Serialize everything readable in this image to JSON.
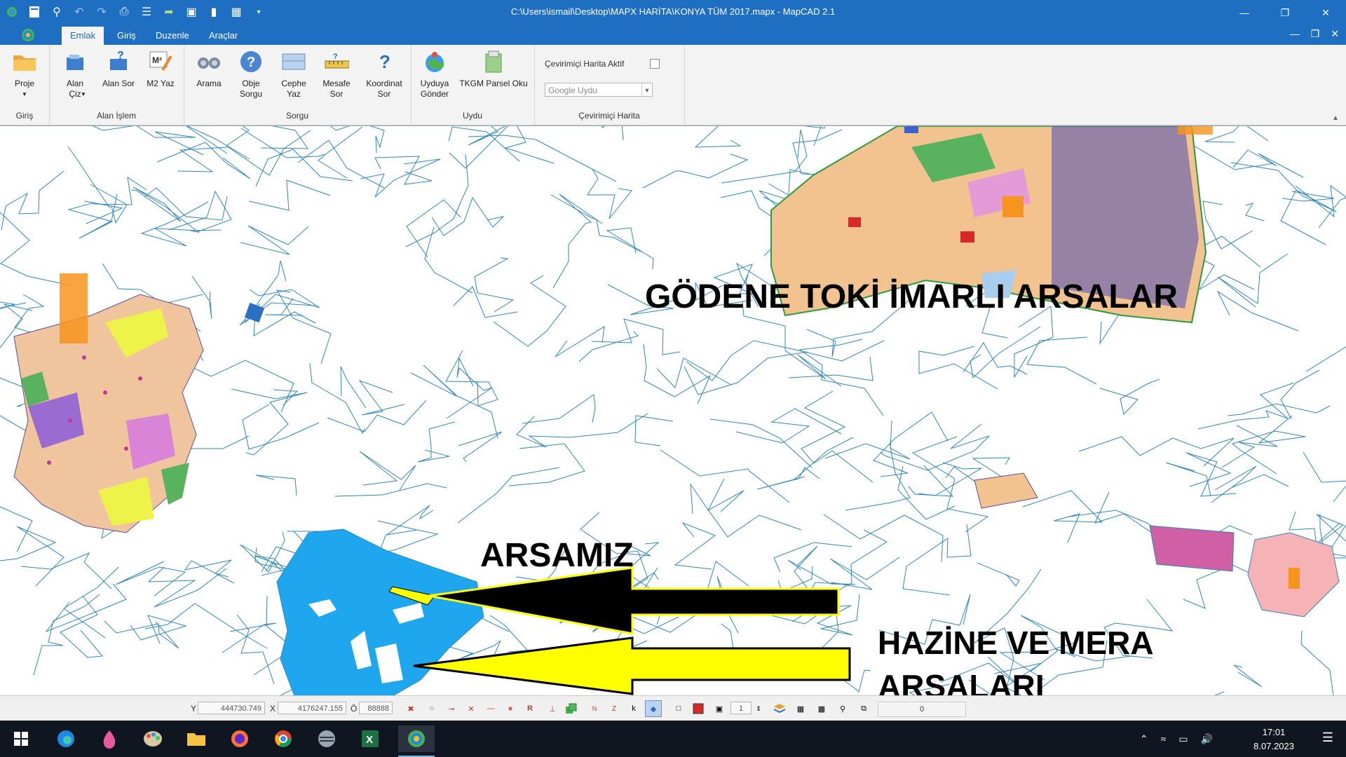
{
  "window": {
    "title": "C:\\Users\\ismail\\Desktop\\MAPX HARİTA\\KONYA TÜM 2017.mapx - MapCAD 2.1",
    "controls": [
      "minimize",
      "restore",
      "close"
    ]
  },
  "quick_access": [
    "app-icon",
    "new-icon",
    "zoom-icon",
    "undo-icon",
    "redo-icon",
    "print-icon",
    "list-icon",
    "export-icon",
    "save-icon",
    "bookmark-icon",
    "layout-icon",
    "dropdown-icon"
  ],
  "tabs": [
    {
      "label": "Emlak",
      "active": true
    },
    {
      "label": "Giriş",
      "active": false
    },
    {
      "label": "Duzenle",
      "active": false
    },
    {
      "label": "Araçlar",
      "active": false
    }
  ],
  "ribbon": {
    "groups": {
      "giris": {
        "label": "Giriş",
        "buttons": [
          {
            "label": "Proje",
            "icon": "folder-icon"
          }
        ]
      },
      "alan_islem": {
        "label": "Alan İşlem",
        "buttons": [
          {
            "label": "Alan Çiz",
            "icon": "draw-area-icon"
          },
          {
            "label": "Alan Sor",
            "icon": "query-area-icon"
          },
          {
            "label": "M2 Yaz",
            "icon": "m2-write-icon"
          }
        ]
      },
      "sorgu": {
        "label": "Sorgu",
        "buttons": [
          {
            "label": "Arama",
            "icon": "binoculars-icon"
          },
          {
            "label": "Obje Sorgu",
            "icon": "question-icon"
          },
          {
            "label": "Cephe Yaz",
            "icon": "facade-icon"
          },
          {
            "label": "Mesafe Sor",
            "icon": "ruler-icon"
          },
          {
            "label": "Koordinat Sor",
            "icon": "coordinate-question-icon"
          }
        ]
      },
      "uydu": {
        "label": "Uydu",
        "buttons": [
          {
            "label": "Uyduya Gönder",
            "icon": "globe-icon"
          },
          {
            "label": "TKGM Parsel Oku",
            "icon": "parcel-read-icon"
          }
        ]
      },
      "cevrimici": {
        "label": "Çevirimiçi Harita",
        "checkbox_label": "Çevirimiçi Harita Aktif",
        "checked": false,
        "combo_value": "Google Uydu"
      }
    }
  },
  "map": {
    "labels": {
      "toki": "GÖDENE TOKİ İMARLI ARSALAR",
      "arsamiz": "ARSAMIZ",
      "hazine_line1": "HAZİNE VE MERA",
      "hazine_line2": "ARSALARI"
    },
    "colors": {
      "line": "#2f86b8",
      "water": "#1ea7ee",
      "residential": "#f2c28f",
      "arrow_yellow": "#ffff00",
      "arrow_black": "#000000",
      "zone_pink": "#d15fa6"
    }
  },
  "status": {
    "y_label": "Y",
    "y_value": "444730.749",
    "x_label": "X",
    "x_value": "4176247.155",
    "o_label": "Ö",
    "o_value": "88888",
    "scale_value": "1",
    "counter": "0"
  },
  "taskbar": {
    "apps": [
      "windows-start-icon",
      "edge-icon",
      "paint-drop-icon",
      "palette-icon",
      "file-explorer-icon",
      "firefox-icon",
      "chrome-icon",
      "network-app-icon",
      "excel-icon",
      "mapcad-icon"
    ],
    "time": "17:01",
    "date": "8.07.2023"
  }
}
